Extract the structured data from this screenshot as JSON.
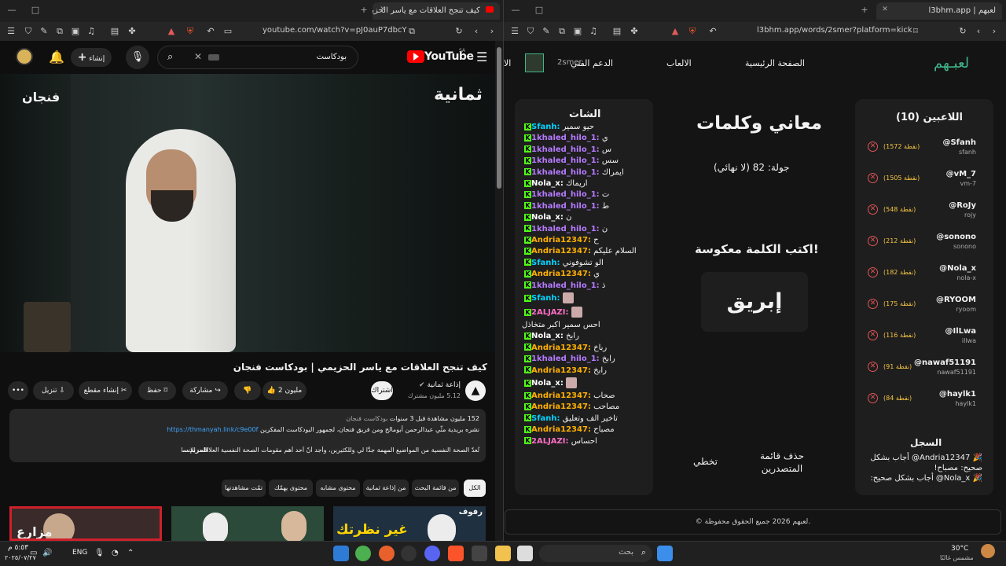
{
  "left_browser": {
    "tab_title": "كيف تنجح العلاقات مع ياسر الحزيم...",
    "url": "youtube.com/watch?v=pJ0auP7dbcY",
    "window_min": "—",
    "window_max": "□",
    "window_close": "✕",
    "new_tab": "+"
  },
  "youtube": {
    "logo": "YouTube",
    "logo_region": "SA",
    "search_text": "بودكاست",
    "create_label": "إنشاء",
    "video_overlay_left": "فنجان",
    "video_overlay_right": "ثمانية",
    "title": "كيف تنجح العلاقات مع ياسر الحزيمي | بودكاست فنجان",
    "channel_name": "إذاعة ثمانية",
    "subscribers": "5.12 مليون مشترك",
    "subscribe_label": "اشتراك",
    "likes": "2 مليون",
    "share_label": "مشاركة",
    "save_label": "حفظ",
    "clip_label": "إنشاء مقطع",
    "download_label": "تنزيل",
    "description_line1": "152 مليون مشاهدة قبل 3 سنوات",
    "description_hashtag": "بودكاست فنجان",
    "description_line2": "نشره بريدية مثّي عبدالرحمن أبومالح ومن فريق فنجان، لجمهور البودكاست المفكرين",
    "description_link": "https://thmanyah.link/c9e00f",
    "description_line3": "تُعدّ الصحة النفسية من المواضيع المهمة جدًّا لي وللكثيرين، وأجد أنّ أحد أهم مقومات الصحة النفسية العلاقات الإنسانية...",
    "more_label": "...المزيد",
    "chips": [
      "الكل",
      "من قائمة البحث",
      "من إذاعة ثمانية",
      "محتوى مشابه",
      "محتوى يهمّك",
      "تمّت مشاهدتها"
    ],
    "thumb_label_1": "رفوف",
    "thumb_text_1": "غير نظرتك",
    "thumb_text_3": "مزارع"
  },
  "right_browser": {
    "tab_title": "لعبهم | l3bhm.app",
    "url": "l3bhm.app/words/2smer?platform=kick",
    "new_tab": "+"
  },
  "app": {
    "logo": "لعبـهم",
    "nav": [
      "الصفحة الرئيسية",
      "الالعاب",
      "الدعم الفني",
      "الا"
    ],
    "username": "2smer",
    "players_title": "اللاعبين (10)",
    "players": [
      {
        "handle": "@Sfanh",
        "sub": "sfanh",
        "points": "(1572 نقطة)"
      },
      {
        "handle": "@vM_7",
        "sub": "vm-7",
        "points": "(1505 نقطة)"
      },
      {
        "handle": "@RoJy",
        "sub": "rojy",
        "points": "(548 نقطة)"
      },
      {
        "handle": "@sonono",
        "sub": "sonono",
        "points": "(212 نقطة)"
      },
      {
        "handle": "@Nola_x",
        "sub": "nola-x",
        "points": "(182 نقطة)"
      },
      {
        "handle": "@RYOOM",
        "sub": "ryoom",
        "points": "(175 نقطة)"
      },
      {
        "handle": "@IlLwa",
        "sub": "illwa",
        "points": "(116 نقطة)"
      },
      {
        "handle": "@nawaf51191",
        "sub": "nawaf51191",
        "points": "(91 نقطة)"
      },
      {
        "handle": "@haylk1",
        "sub": "haylk1",
        "points": "(84 نقطة)"
      }
    ],
    "log_title": "السجل",
    "log_lines": [
      "Andria12347@ أجاب بشكل",
      "صحيح: مصباح!",
      "Nola_x@ أجاب بشكل صحيح:"
    ],
    "game_title": "معاني وكلمات",
    "round": "جولة: 82 (لا نهائي)",
    "prompt": "اكتب الكلمة معكوسة!",
    "word": "إبريق",
    "clear_btn_1": "حذف قائمة",
    "clear_btn_2": "المتصدرين",
    "skip_btn": "تخطي",
    "chat_title": "الشات",
    "chat": [
      {
        "user": "Sfanh",
        "msg": "حيو سمير",
        "color": "#00d4ff"
      },
      {
        "user": "1khaled_hilo_1",
        "msg": "ي",
        "color": "#b57bff"
      },
      {
        "user": "1khaled_hilo_1",
        "msg": "س",
        "color": "#b57bff"
      },
      {
        "user": "1khaled_hilo_1",
        "msg": "سس",
        "color": "#b57bff"
      },
      {
        "user": "1khaled_hilo_1",
        "msg": "ايمراك",
        "color": "#b57bff"
      },
      {
        "user": "Nola_x",
        "msg": "اريماك",
        "color": "#ffffff"
      },
      {
        "user": "1khaled_hilo_1",
        "msg": "ت",
        "color": "#b57bff"
      },
      {
        "user": "1khaled_hilo_1",
        "msg": "ط",
        "color": "#b57bff"
      },
      {
        "user": "Nola_x",
        "msg": "ن",
        "color": "#ffffff"
      },
      {
        "user": "1khaled_hilo_1",
        "msg": "ن",
        "color": "#b57bff"
      },
      {
        "user": "Andria12347",
        "msg": "ح",
        "color": "#ffb000"
      },
      {
        "user": "Andria12347",
        "msg": "السلام عليكم",
        "color": "#ffb000"
      },
      {
        "user": "Sfanh",
        "msg": "الو تشوفوني",
        "color": "#00d4ff"
      },
      {
        "user": "Andria12347",
        "msg": "ي",
        "color": "#ffb000"
      },
      {
        "user": "1khaled_hilo_1",
        "msg": "ذ",
        "color": "#b57bff"
      },
      {
        "user": "Sfanh",
        "msg": "",
        "color": "#00d4ff"
      },
      {
        "user": "2ALJAZI",
        "msg": "",
        "color": "#ff6ec7"
      },
      {
        "user": "",
        "msg": "احس سمير اكبر متخاذل",
        "color": "#ffffff"
      },
      {
        "user": "Nola_x",
        "msg": "رابخ",
        "color": "#ffffff"
      },
      {
        "user": "Andria12347",
        "msg": "رباخ",
        "color": "#ffb000"
      },
      {
        "user": "1khaled_hilo_1",
        "msg": "رابخ",
        "color": "#b57bff"
      },
      {
        "user": "Andria12347",
        "msg": "رابخ",
        "color": "#ffb000"
      },
      {
        "user": "Nola_x",
        "msg": "",
        "color": "#ffffff"
      },
      {
        "user": "Andria12347",
        "msg": "صحاب",
        "color": "#ffb000"
      },
      {
        "user": "Andria12347",
        "msg": "مصاحب",
        "color": "#ffb000"
      },
      {
        "user": "Sfanh",
        "msg": "تاخير الف وتعليق",
        "color": "#00d4ff"
      },
      {
        "user": "Andria12347",
        "msg": "مصباح",
        "color": "#ffb000"
      },
      {
        "user": "2ALJAZI",
        "msg": "احساس",
        "color": "#ff6ec7"
      }
    ],
    "footer": "© لعبهم 2026 جميع الحقوق محفوظة."
  },
  "taskbar": {
    "search_placeholder": "بحث",
    "lang": "ENG",
    "time": "٥:٥٣ م",
    "date": "٢٠٢٥/٠٧/٢٧",
    "weather_temp": "30°C",
    "weather_desc": "مشمس غالبًا"
  }
}
